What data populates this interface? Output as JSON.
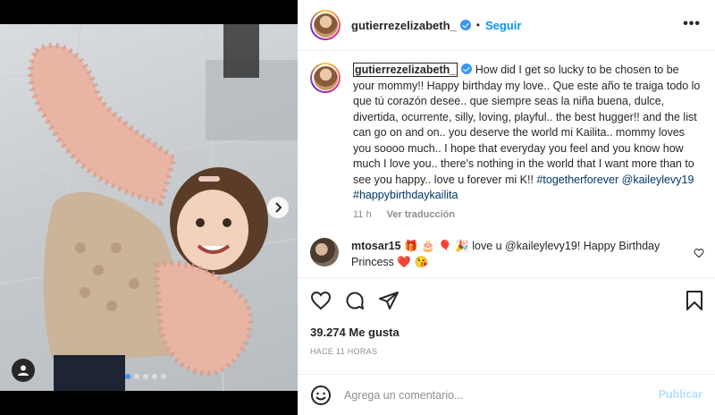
{
  "post": {
    "username": "gutierrezelizabeth_",
    "follow_label": "Seguir",
    "more_label": "•••",
    "caption_body": "How did I get so lucky to be chosen to be your mommy!! Happy birthday my love.. Que este año te traiga todo lo que tú corazón desee.. que siempre seas la niña buena, dulce, divertida, ocurrente, silly, loving, playful.. the best hugger!! and the list can go on and on.. you deserve the world mi Kailita.. mommy loves you soooo much.. I hope that everyday you feel and you know how much I love you.. there's nothing in the world that I want more than to see you happy.. love u forever mi K!! ",
    "caption_tags": "#togetherforever @kaileylevy19 #happybirthdaykailita",
    "time_ago": "11 h",
    "translate_label": "Ver traducción",
    "likes": "39.274 Me gusta",
    "posted_ago": "HACE 11 HORAS"
  },
  "comment": {
    "username": "mtosar15",
    "text": "🎁 🎂 🎈 🎉 love u @kaileylevy19! Happy Birthday Princess ❤️ 😘"
  },
  "add_comment": {
    "placeholder": "Agrega un comentario...",
    "publish_label": "Publicar"
  },
  "media": {
    "carousel_total": 5,
    "carousel_active": 1
  },
  "colors": {
    "accent": "#0095f6",
    "verified": "#3897f0",
    "hashtag": "#00376b",
    "muted": "#8e8e8e"
  },
  "icons": [
    "chevron-right-icon",
    "user-tag-icon",
    "heart-icon",
    "comment-icon",
    "share-icon",
    "bookmark-icon",
    "emoji-icon",
    "verified-icon"
  ]
}
